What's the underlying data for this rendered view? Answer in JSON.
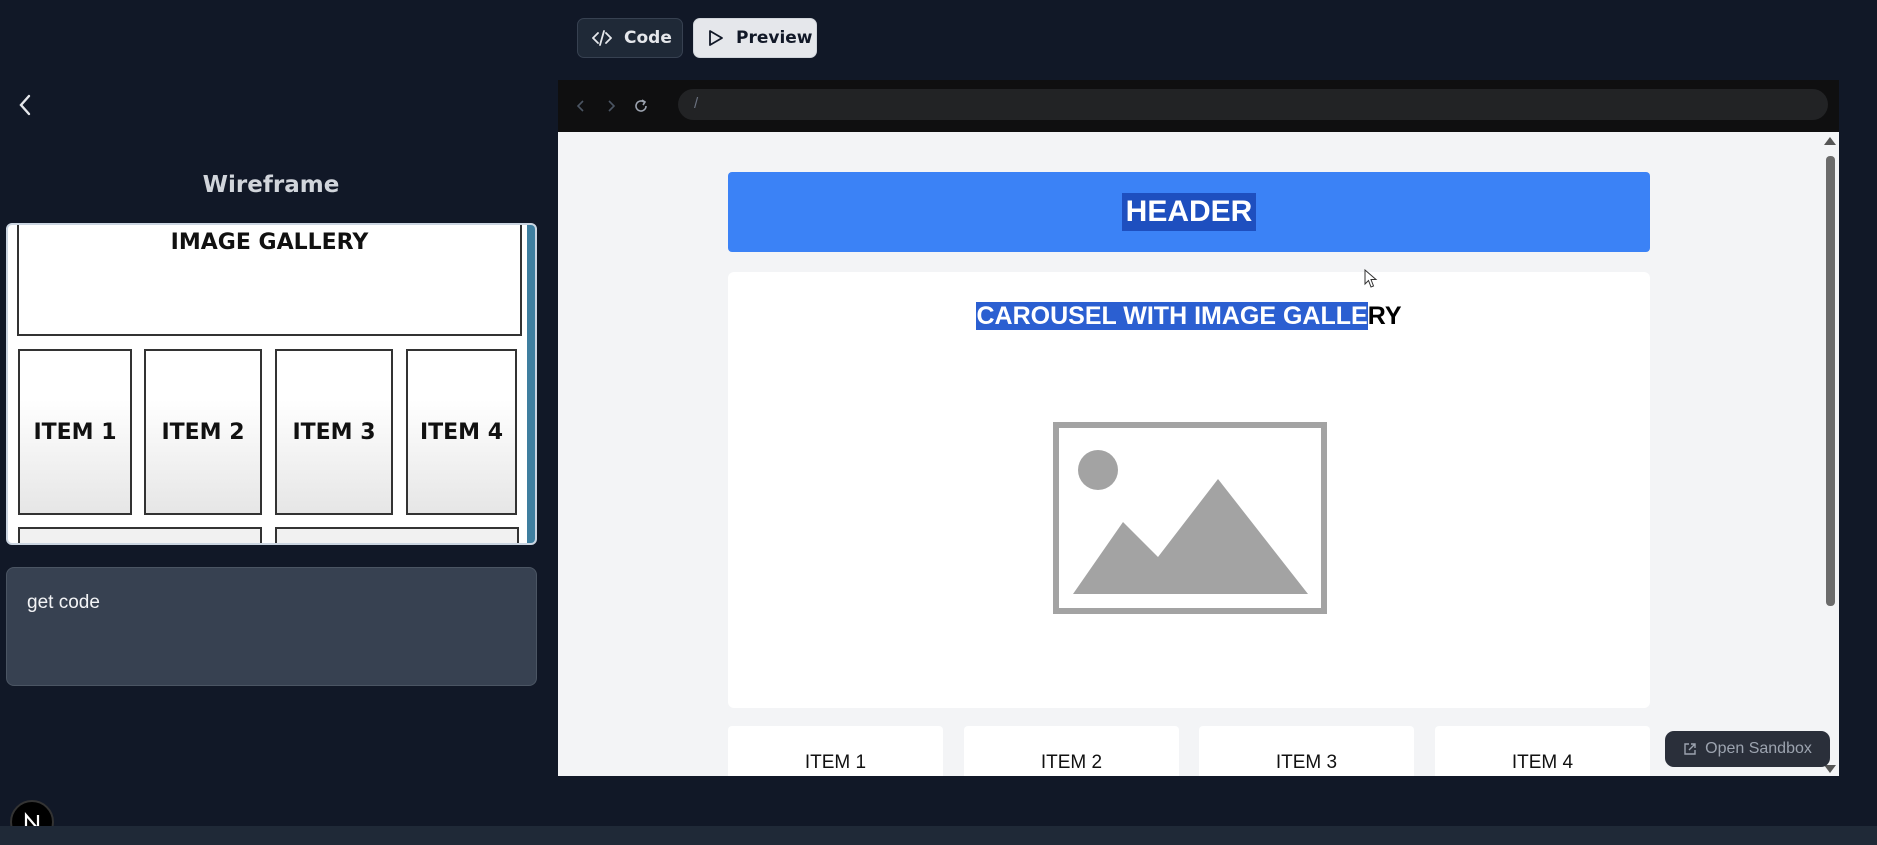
{
  "toolbar": {
    "code_label": "Code",
    "preview_label": "Preview"
  },
  "left_panel": {
    "title": "Wireframe",
    "wireframe": {
      "heading": "IMAGE GALLERY",
      "items": [
        "ITEM 1",
        "ITEM 2",
        "ITEM 3",
        "ITEM 4"
      ]
    },
    "prompt_text": "get code"
  },
  "browser": {
    "url": "/"
  },
  "preview": {
    "header_text": "HEADER",
    "carousel_title_selected": "CAROUSEL WITH IMAGE GALLE",
    "carousel_title_rest": "RY",
    "items": [
      "ITEM 1",
      "ITEM 2",
      "ITEM 3",
      "ITEM 4"
    ],
    "open_sandbox_label": "Open Sandbox"
  },
  "badge_letter": "N",
  "colors": {
    "background": "#111827",
    "header_blue": "#3b82f6",
    "selection": "#2b5fd1"
  }
}
